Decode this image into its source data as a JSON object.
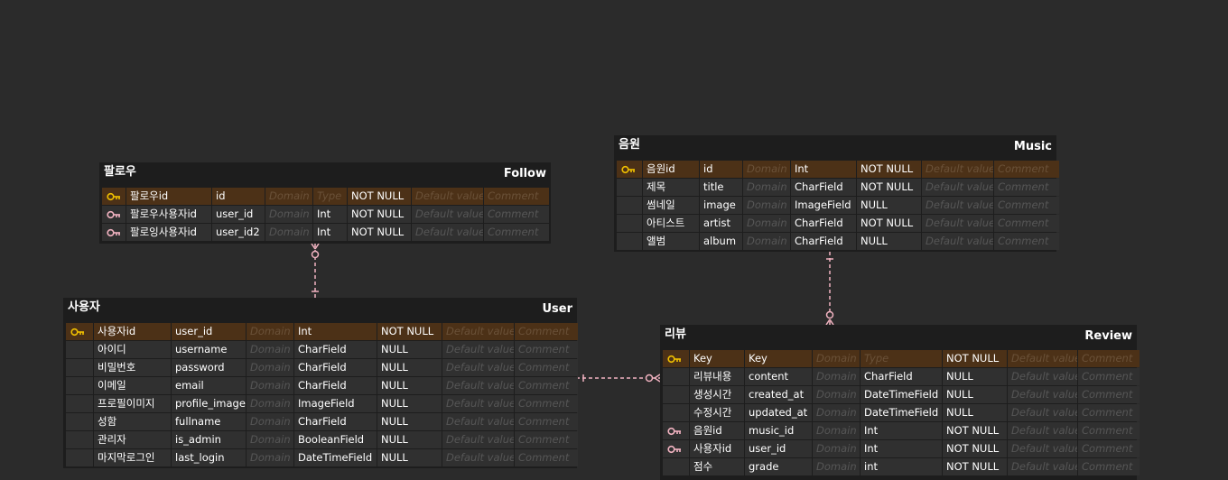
{
  "colors": {
    "pk_key": "#f0c000",
    "fk_key": "#f2b3c1",
    "relation": "#f2b3c1",
    "pk_row": "#4c3117"
  },
  "tables": [
    {
      "id": "follow",
      "title_ko": "팔로우",
      "title_en": "Follow",
      "rows": [
        {
          "key": "pk",
          "logical": "팔로우id",
          "physical": "id",
          "domain": "Domain",
          "type": "Type",
          "null": "NOT NULL",
          "default": "Default value",
          "comment": "Comment"
        },
        {
          "key": "fk",
          "logical": "팔로우사용자id",
          "physical": "user_id",
          "domain": "Domain",
          "type": "Int",
          "null": "NOT NULL",
          "default": "Default value",
          "comment": "Comment"
        },
        {
          "key": "fk",
          "logical": "팔로잉사용자id",
          "physical": "user_id2",
          "domain": "Domain",
          "type": "Int",
          "null": "NOT NULL",
          "default": "Default value",
          "comment": "Comment"
        }
      ]
    },
    {
      "id": "music",
      "title_ko": "음원",
      "title_en": "Music",
      "rows": [
        {
          "key": "pk",
          "logical": "음원id",
          "physical": "id",
          "domain": "Domain",
          "type": "Int",
          "null": "NOT NULL",
          "default": "Default value",
          "comment": "Comment"
        },
        {
          "key": "",
          "logical": "제목",
          "physical": "title",
          "domain": "Domain",
          "type": "CharField",
          "null": "NOT NULL",
          "default": "Default value",
          "comment": "Comment"
        },
        {
          "key": "",
          "logical": "썸네일",
          "physical": "image",
          "domain": "Domain",
          "type": "ImageField",
          "null": "NULL",
          "default": "Default value",
          "comment": "Comment"
        },
        {
          "key": "",
          "logical": "아티스트",
          "physical": "artist",
          "domain": "Domain",
          "type": "CharField",
          "null": "NOT NULL",
          "default": "Default value",
          "comment": "Comment"
        },
        {
          "key": "",
          "logical": "앨범",
          "physical": "album",
          "domain": "Domain",
          "type": "CharField",
          "null": "NULL",
          "default": "Default value",
          "comment": "Comment"
        }
      ]
    },
    {
      "id": "user",
      "title_ko": "사용자",
      "title_en": "User",
      "rows": [
        {
          "key": "pk",
          "logical": "사용자id",
          "physical": "user_id",
          "domain": "Domain",
          "type": "Int",
          "null": "NOT NULL",
          "default": "Default value",
          "comment": "Comment"
        },
        {
          "key": "",
          "logical": "아이디",
          "physical": "username",
          "domain": "Domain",
          "type": "CharField",
          "null": "NULL",
          "default": "Default value",
          "comment": "Comment"
        },
        {
          "key": "",
          "logical": "비밀번호",
          "physical": "password",
          "domain": "Domain",
          "type": "CharField",
          "null": "NULL",
          "default": "Default value",
          "comment": "Comment"
        },
        {
          "key": "",
          "logical": "이메일",
          "physical": "email",
          "domain": "Domain",
          "type": "CharField",
          "null": "NULL",
          "default": "Default value",
          "comment": "Comment"
        },
        {
          "key": "",
          "logical": "프로필이미지",
          "physical": "profile_image",
          "domain": "Domain",
          "type": "ImageField",
          "null": "NULL",
          "default": "Default value",
          "comment": "Comment"
        },
        {
          "key": "",
          "logical": "성함",
          "physical": "fullname",
          "domain": "Domain",
          "type": "CharField",
          "null": "NULL",
          "default": "Default value",
          "comment": "Comment"
        },
        {
          "key": "",
          "logical": "관리자",
          "physical": "is_admin",
          "domain": "Domain",
          "type": "BooleanField",
          "null": "NULL",
          "default": "Default value",
          "comment": "Comment"
        },
        {
          "key": "",
          "logical": "마지막로그인",
          "physical": "last_login",
          "domain": "Domain",
          "type": "DateTimeField",
          "null": "NULL",
          "default": "Default value",
          "comment": "Comment"
        }
      ]
    },
    {
      "id": "review",
      "title_ko": "리뷰",
      "title_en": "Review",
      "rows": [
        {
          "key": "pk",
          "logical": "Key",
          "physical": "Key",
          "domain": "Domain",
          "type": "Type",
          "null": "NOT NULL",
          "default": "Default value",
          "comment": "Comment"
        },
        {
          "key": "",
          "logical": "리뷰내용",
          "physical": "content",
          "domain": "Domain",
          "type": "CharField",
          "null": "NULL",
          "default": "Default value",
          "comment": "Comment"
        },
        {
          "key": "",
          "logical": "생성시간",
          "physical": "created_at",
          "domain": "Domain",
          "type": "DateTimeField",
          "null": "NULL",
          "default": "Default value",
          "comment": "Comment"
        },
        {
          "key": "",
          "logical": "수정시간",
          "physical": "updated_at",
          "domain": "Domain",
          "type": "DateTimeField",
          "null": "NULL",
          "default": "Default value",
          "comment": "Comment"
        },
        {
          "key": "fk",
          "logical": "음원id",
          "physical": "music_id",
          "domain": "Domain",
          "type": "Int",
          "null": "NOT NULL",
          "default": "Default value",
          "comment": "Comment"
        },
        {
          "key": "fk",
          "logical": "사용자id",
          "physical": "user_id",
          "domain": "Domain",
          "type": "Int",
          "null": "NOT NULL",
          "default": "Default value",
          "comment": "Comment"
        },
        {
          "key": "",
          "logical": "점수",
          "physical": "grade",
          "domain": "Domain",
          "type": "int",
          "null": "NOT NULL",
          "default": "Default value",
          "comment": "Comment"
        }
      ]
    }
  ],
  "relations": [
    {
      "from": "user",
      "to": "follow",
      "cardinality": "one-to-many"
    },
    {
      "from": "music",
      "to": "review",
      "cardinality": "one-to-many"
    },
    {
      "from": "user",
      "to": "review",
      "cardinality": "one-to-many"
    }
  ]
}
